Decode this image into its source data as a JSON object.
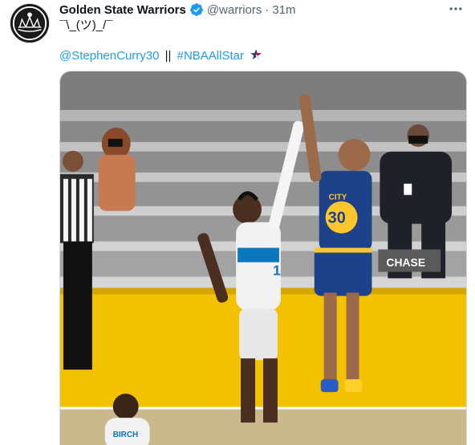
{
  "tweet": {
    "author": {
      "display_name": "Golden State Warriors",
      "handle": "@warriors",
      "verified": true,
      "avatar_icon": "warriors-logo-icon"
    },
    "separator": "·",
    "timestamp": "31m",
    "more_icon": "more-options-icon",
    "text_line_1": "¯\\_(ツ)_/¯",
    "mention": "@StephenCurry30",
    "divider": "||",
    "hashtag": "#NBAAllStar",
    "hashtag_emoji": "nba-all-star-star-icon",
    "media": {
      "type": "video-thumbnail",
      "sponsor_text": "CHASE",
      "jersey_number": "30",
      "jersey_text": "CITY",
      "defender_number": "1",
      "foreground_jersey_text": "BIRCH"
    }
  },
  "colors": {
    "link": "#1d9bf0",
    "text_primary": "#0f1419",
    "text_secondary": "#536471",
    "court_yellow": "#f2c200",
    "warriors_blue": "#1d428a",
    "warriors_gold": "#ffc72c"
  }
}
